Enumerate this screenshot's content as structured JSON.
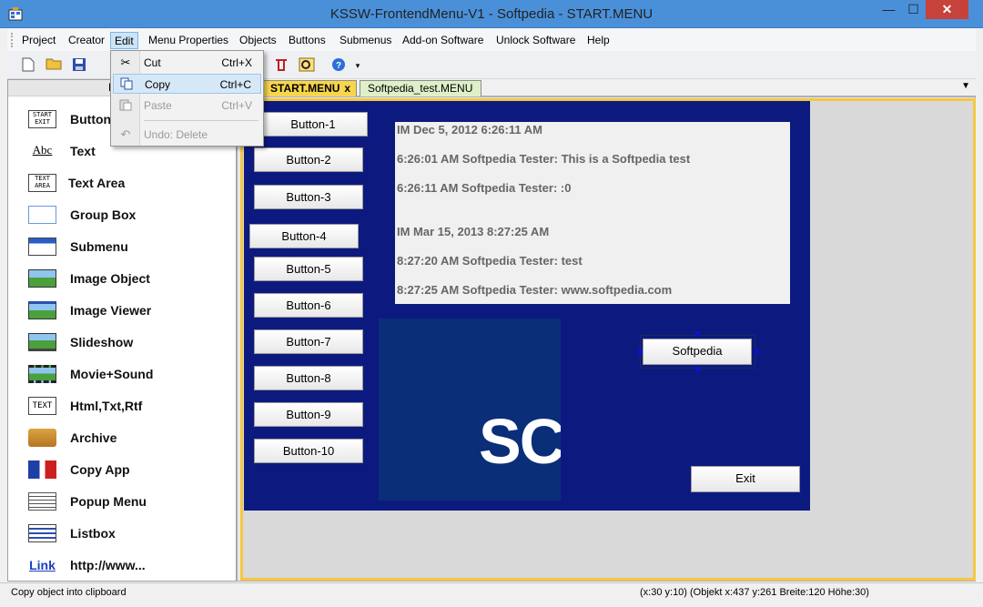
{
  "window": {
    "title": "KSSW-FrontendMenu-V1  -  Softpedia  -  START.MENU",
    "minimize": "—",
    "maximize": "☐",
    "close": "✕"
  },
  "menubar": {
    "items": [
      "Project",
      "Creator",
      "Edit",
      "Menu Properties",
      "Objects",
      "Buttons",
      "Submenus",
      "Add-on Software",
      "Unlock Software",
      "Help"
    ]
  },
  "edit_menu": {
    "items": [
      {
        "label": "Cut",
        "shortcut": "Ctrl+X",
        "icon": "scissors-icon"
      },
      {
        "label": "Copy",
        "shortcut": "Ctrl+C",
        "icon": "copy-icon"
      },
      {
        "label": "Paste",
        "shortcut": "Ctrl+V",
        "icon": "paste-icon"
      },
      {
        "label": "Undo: Delete",
        "shortcut": "",
        "icon": "undo-icon"
      }
    ]
  },
  "left_panel": {
    "header": "Menu",
    "items": [
      {
        "label": "Button",
        "icon_text": "START EXIT"
      },
      {
        "label": "Text",
        "icon_text": "Abc"
      },
      {
        "label": "Text Area",
        "icon_text": "TEXT AREA"
      },
      {
        "label": "Group Box",
        "icon_text": ""
      },
      {
        "label": "Submenu",
        "icon_text": ""
      },
      {
        "label": "Image Object",
        "icon_text": ""
      },
      {
        "label": "Image Viewer",
        "icon_text": ""
      },
      {
        "label": "Slideshow",
        "icon_text": ""
      },
      {
        "label": "Movie+Sound",
        "icon_text": ""
      },
      {
        "label": "Html,Txt,Rtf",
        "icon_text": "TEXT"
      },
      {
        "label": "Archive",
        "icon_text": ""
      },
      {
        "label": "Copy App",
        "icon_text": ""
      },
      {
        "label": "Popup Menu",
        "icon_text": ""
      },
      {
        "label": "Listbox",
        "icon_text": ""
      },
      {
        "label": "http://www...",
        "icon_text": "Link"
      }
    ]
  },
  "tabs": [
    {
      "label": "START.MENU",
      "close": "x"
    },
    {
      "label": "Softpedia_test.MENU"
    }
  ],
  "canvas": {
    "buttons": [
      "Button-1",
      "Button-2",
      "Button-3",
      "Button-4",
      "Button-5",
      "Button-6",
      "Button-7",
      "Button-8",
      "Button-9",
      "Button-10"
    ],
    "text_lines": [
      "IM Dec 5, 2012 6:26:11 AM",
      "6:26:01 AM Softpedia Tester: This is a Softpedia test",
      "6:26:11 AM Softpedia Tester: :0",
      "IM Mar 15, 2013 8:27:25 AM",
      "8:27:20 AM Softpedia Tester: test",
      "8:27:25 AM Softpedia Tester: www.softpedia.com"
    ],
    "image_logo_text": "SC",
    "softpedia_button": "Softpedia",
    "exit_button": "Exit"
  },
  "statusbar": {
    "left": "Copy object into clipboard",
    "right": "(x:30 y:10) (Objekt x:437 y:261 Breite:120 Höhe:30)"
  }
}
